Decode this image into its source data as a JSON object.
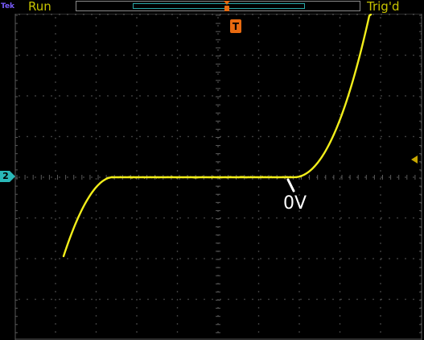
{
  "status": {
    "brand": "Tek",
    "acquisition": "Run",
    "trigger_state": "Trig'd"
  },
  "channel_marker": {
    "label": "2",
    "color": "#2ab8b8"
  },
  "trigger_marker": {
    "label": "T",
    "color": "#e86a10"
  },
  "trace": {
    "color": "#f2ee1a"
  },
  "annotation": {
    "text": "0V",
    "color": "#ffffff"
  },
  "colors": {
    "background": "#000000",
    "graticule": "#5a5a5a",
    "status_text": "#c8c400",
    "brand": "#7a5cff",
    "record_window": "#2aa8a8",
    "trigger_level": "#c8a800"
  },
  "icons": {
    "trigger_position": "orange-t-arrow-icon",
    "trigger_level": "yellow-left-arrow-icon",
    "channel_ground": "teal-ground-marker-icon"
  }
}
